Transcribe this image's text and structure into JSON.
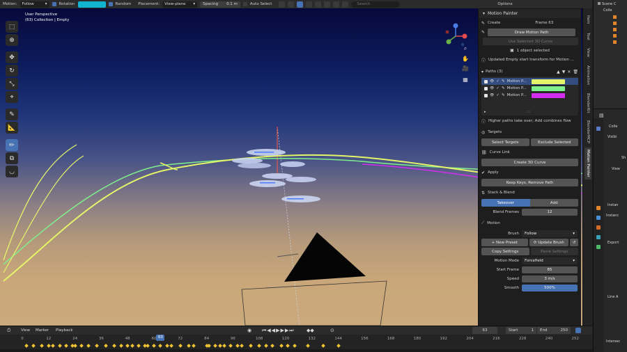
{
  "topbar": {
    "motion_label": "Motion:",
    "motion_value": "Follow",
    "rotation_label": "Rotation",
    "random_label": "Random",
    "placement_label": "Placement:",
    "placement_value": "View-plane",
    "spacing_label": "Spacing",
    "spacing_value": "0.1 m",
    "auto_select_label": "Auto Select",
    "search_placeholder": "Search",
    "options_label": "Options",
    "brush_color": "#12b3cf"
  },
  "viewport": {
    "perspective": "User Perspective",
    "collection": "(63) Collection | Empty",
    "path_colors": [
      "#e5f56a",
      "#7ff08c",
      "#d32df0"
    ]
  },
  "toolbar": {
    "tools": [
      "select-box-icon",
      "cursor-icon",
      "move-icon",
      "rotate-icon",
      "scale-icon",
      "transform-icon",
      "annotate-icon",
      "measure-icon",
      "motion-paint-icon",
      "add-cube-icon",
      "curve-icon"
    ]
  },
  "panel": {
    "title": "Motion Painter",
    "create_header": "Create",
    "frame_label": "Frame 63",
    "draw_motion_path": "Draw Motion Path",
    "use_selected_curve": "Use Selected 3D Curve",
    "objects_selected": "1 object selected",
    "status_message": "Updated Empty start transform for Motion ...",
    "paths_header": "Paths (3)",
    "paths": [
      {
        "name": "Motion P...",
        "color": "#e5f56a"
      },
      {
        "name": "Motion P...",
        "color": "#7ff08c"
      },
      {
        "name": "Motion P...",
        "color": "#d32df0"
      }
    ],
    "paths_note": "Higher paths take over; Add combines flow",
    "list_grip": "::::",
    "targets_header": "Targets",
    "select_targets": "Select Targets",
    "exclude_selected": "Exclude Selected",
    "curve_link_header": "Curve Link",
    "create_3d_curve": "Create 3D Curve",
    "apply_header": "Apply",
    "keep_keys": "Keep Keys, Remove Path",
    "stack_header": "Stack & Blend",
    "takeover": "Takeover",
    "add": "Add",
    "blend_frames_label": "Blend Frames",
    "blend_frames_value": "12",
    "motion_header": "Motion",
    "brush_label": "Brush",
    "brush_value": "Follow",
    "new_preset": "New Preset",
    "update_brush": "Update Brush",
    "copy_settings": "Copy Settings",
    "paste_settings": "Paste Settings",
    "motion_mode_label": "Motion Mode",
    "motion_mode_value": "Forcefield",
    "start_frame_label": "Start Frame",
    "start_frame_value": "85",
    "speed_label": "Speed",
    "speed_value": "3 m/s",
    "smooth_label": "Smooth",
    "smooth_value": "500%"
  },
  "vtabs": [
    "Item",
    "Tool",
    "View",
    "Animation",
    "BlenderKit",
    "BlenderMCP",
    "Motion Painter"
  ],
  "rcol": {
    "scene": "Scene C",
    "colle": "Colle",
    "collection_short": "Colle",
    "visibility": "Visibi",
    "sh": "Sh",
    "view": "View",
    "instancing": "Instan",
    "instance": "Instanc",
    "export": "Export",
    "line_art": "Line A",
    "intersection": "Intersec"
  },
  "timeline": {
    "view": "View",
    "marker": "Marker",
    "playback": "Playback",
    "current_frame": "63",
    "start_label": "Start",
    "start_value": "1",
    "end_label": "End",
    "end_value": "250",
    "ticks": [
      "0",
      "12",
      "24",
      "36",
      "48",
      "60",
      "72",
      "84",
      "96",
      "108",
      "120",
      "132",
      "144",
      "156",
      "168",
      "180",
      "192",
      "204",
      "216",
      "228",
      "240",
      "252"
    ],
    "playhead": "63",
    "keyframes": [
      2,
      5,
      9,
      12,
      14,
      17,
      20,
      23,
      24,
      27,
      30,
      34,
      38,
      42,
      45,
      48,
      50,
      53,
      56,
      57,
      60,
      63,
      66,
      68,
      72,
      76,
      78,
      84,
      85,
      88,
      90,
      92,
      95,
      98,
      100,
      104,
      108,
      111,
      114,
      118,
      121,
      124,
      130,
      137,
      144
    ]
  }
}
